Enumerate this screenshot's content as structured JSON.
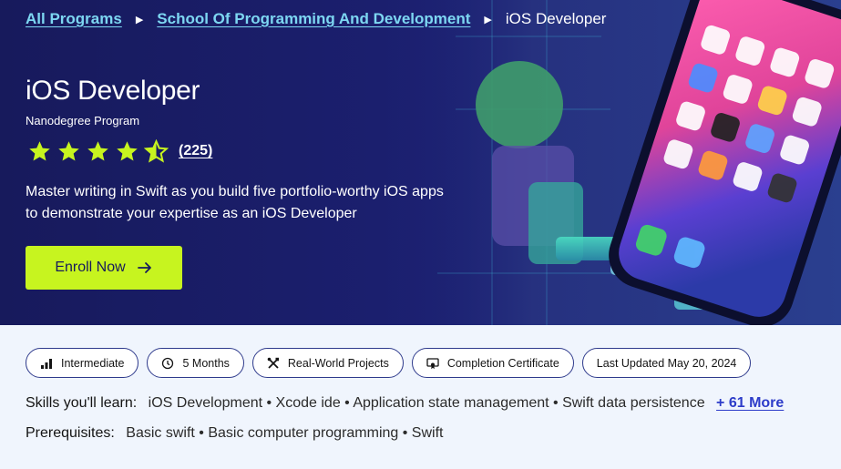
{
  "breadcrumb": {
    "items": [
      "All Programs",
      "School Of Programming And Development"
    ],
    "current": "iOS Developer"
  },
  "hero": {
    "title": "iOS Developer",
    "subtitle": "Nanodegree Program",
    "rating_value": 4.5,
    "rating_count": "(225)",
    "description": "Master writing in Swift as you build five portfolio-worthy iOS apps to demonstrate your expertise as an iOS Developer",
    "enroll_label": "Enroll Now"
  },
  "chips": [
    {
      "label": "Intermediate",
      "icon": "bar-chart-icon"
    },
    {
      "label": "5 Months",
      "icon": "clock-icon"
    },
    {
      "label": "Real-World Projects",
      "icon": "tools-icon"
    },
    {
      "label": "Completion Certificate",
      "icon": "certificate-icon"
    },
    {
      "label": "Last Updated May 20, 2024",
      "icon": ""
    }
  ],
  "skills": {
    "label": "Skills you'll learn:",
    "value": "iOS Development • Xcode ide • Application state management • Swift data persistence",
    "more": "+ 61 More"
  },
  "prerequisites": {
    "label": "Prerequisites:",
    "value": "Basic swift • Basic computer programming • Swift"
  },
  "colors": {
    "hero_bg": "#1b1f6e",
    "accent_lime": "#c7f41f",
    "link_cyan": "#7dd7f2",
    "link_blue": "#2d3cc9"
  }
}
